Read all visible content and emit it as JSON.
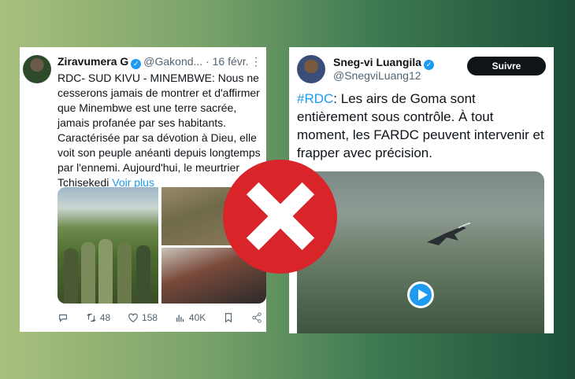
{
  "left_tweet": {
    "name": "Ziravumera G",
    "handle": "@Gakond...",
    "date": "· 16 févr.",
    "more": "⋮",
    "text": "RDC- SUD KIVU - MINEMBWE: Nous ne cesserons jamais de montrer et d'affirmer que Minembwe est une terre sacrée, jamais profanée par ses habitants. Caractérisée par sa dévotion à Dieu, elle voit son peuple anéanti depuis longtemps par l'ennemi. Aujourd'hui, le meurtrier Tchisekedi",
    "voir_plus": "Voir plus",
    "retweets": "48",
    "likes": "158",
    "views": "40K"
  },
  "right_tweet": {
    "name": "Sneg-vi Luangila",
    "handle": "@SnegviLuang12",
    "follow_label": "Suivre",
    "hashtag": "#RDC",
    "text": ": Les airs de Goma sont entièrement sous contrôle. À tout moment, les FARDC peuvent intervenir et frapper avec précision."
  },
  "colors": {
    "verified": "#1d9bf0",
    "x_red": "#d9252a"
  }
}
